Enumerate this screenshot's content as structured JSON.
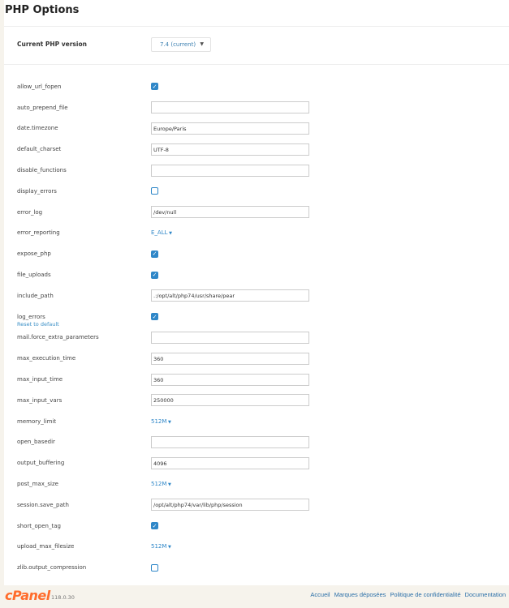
{
  "header": {
    "title": "PHP Options"
  },
  "version": {
    "label": "Current PHP version",
    "selected": "7.4 (current)"
  },
  "options": [
    {
      "name": "allow_url_fopen",
      "type": "checkbox",
      "checked": true
    },
    {
      "name": "auto_prepend_file",
      "type": "text",
      "value": ""
    },
    {
      "name": "date.timezone",
      "type": "text",
      "value": "Europe/Paris"
    },
    {
      "name": "default_charset",
      "type": "text",
      "value": "UTF-8"
    },
    {
      "name": "disable_functions",
      "type": "text",
      "value": ""
    },
    {
      "name": "display_errors",
      "type": "checkbox",
      "checked": false
    },
    {
      "name": "error_log",
      "type": "text",
      "value": "/dev/null"
    },
    {
      "name": "error_reporting",
      "type": "dropdown",
      "value": "E_ALL"
    },
    {
      "name": "expose_php",
      "type": "checkbox",
      "checked": true
    },
    {
      "name": "file_uploads",
      "type": "checkbox",
      "checked": true
    },
    {
      "name": "include_path",
      "type": "text",
      "value": ".:/opt/alt/php74/usr/share/pear"
    },
    {
      "name": "log_errors",
      "type": "checkbox",
      "checked": true,
      "reset": "Reset to default"
    },
    {
      "name": "mail.force_extra_parameters",
      "type": "text",
      "value": ""
    },
    {
      "name": "max_execution_time",
      "type": "text",
      "value": "360"
    },
    {
      "name": "max_input_time",
      "type": "text",
      "value": "360"
    },
    {
      "name": "max_input_vars",
      "type": "text",
      "value": "250000"
    },
    {
      "name": "memory_limit",
      "type": "dropdown",
      "value": "512M"
    },
    {
      "name": "open_basedir",
      "type": "text",
      "value": ""
    },
    {
      "name": "output_buffering",
      "type": "text",
      "value": "4096"
    },
    {
      "name": "post_max_size",
      "type": "dropdown",
      "value": "512M"
    },
    {
      "name": "session.save_path",
      "type": "text",
      "value": "/opt/alt/php74/var/lib/php/session"
    },
    {
      "name": "short_open_tag",
      "type": "checkbox",
      "checked": true
    },
    {
      "name": "upload_max_filesize",
      "type": "dropdown",
      "value": "512M"
    },
    {
      "name": "zlib.output_compression",
      "type": "checkbox",
      "checked": false
    }
  ],
  "footer": {
    "logo": "cPanel",
    "version": "118.0.30",
    "links": [
      "Accueil",
      "Marques déposées",
      "Politique de confidentialité",
      "Documentation"
    ]
  }
}
